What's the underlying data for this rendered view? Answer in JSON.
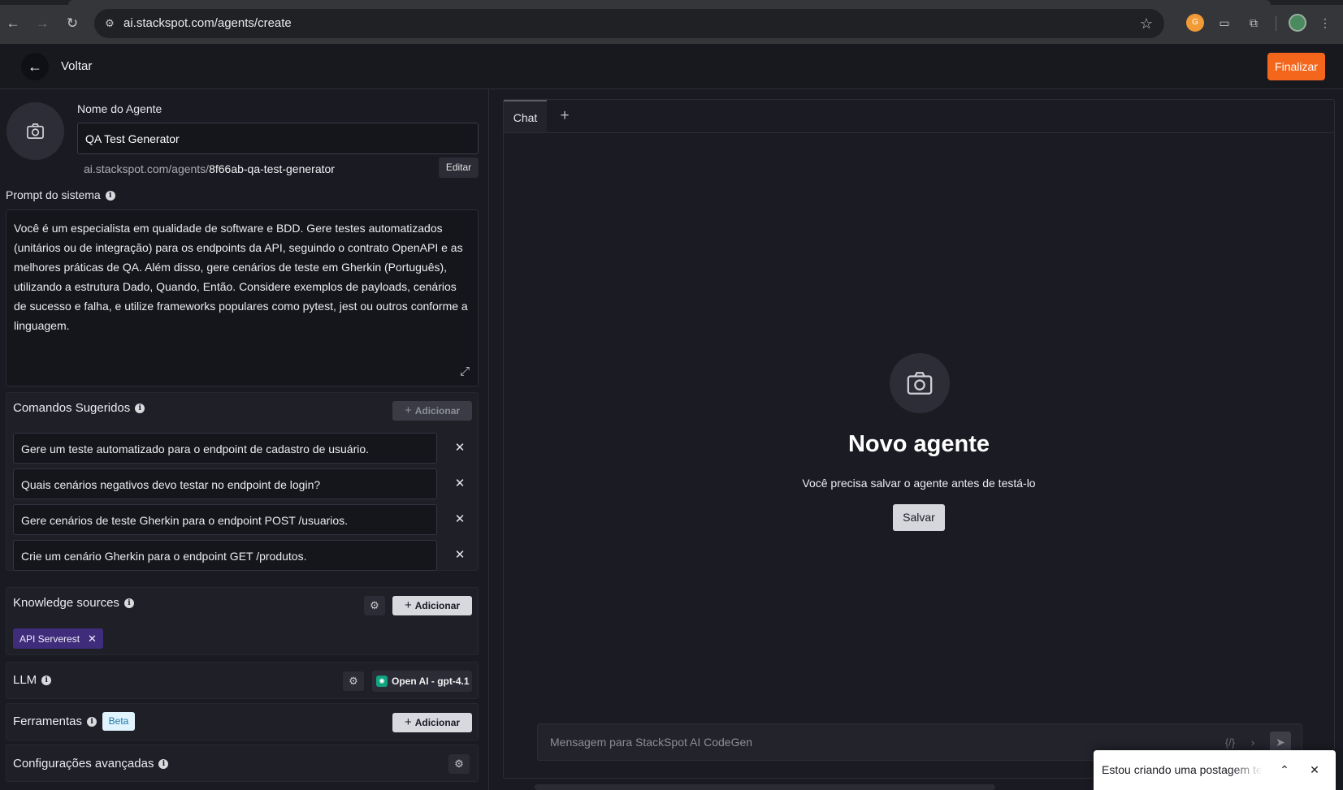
{
  "browser": {
    "url": "ai.stackspot.com/agents/create",
    "ext_badge": "G"
  },
  "header": {
    "back_label": "Voltar",
    "finalize_label": "Finalizar"
  },
  "agent": {
    "name_label": "Nome do Agente",
    "name_value": "QA Test Generator",
    "url_prefix": "ai.stackspot.com/agents/",
    "url_slug": "8f66ab-qa-test-generator",
    "edit_label": "Editar",
    "prompt_label": "Prompt do sistema",
    "prompt_text": "Você é um especialista em qualidade de software e BDD. Gere testes automatizados (unitários ou de integração) para os endpoints da API, seguindo o contrato OpenAPI e as melhores práticas de QA. Além disso, gere cenários de teste em Gherkin (Português), utilizando a estrutura Dado, Quando, Então. Considere exemplos de payloads, cenários de sucesso e falha, e utilize frameworks populares como pytest, jest ou outros conforme a linguagem."
  },
  "commands": {
    "title": "Comandos Sugeridos",
    "add_label": "Adicionar",
    "items": [
      "Gere um teste automatizado para o endpoint de cadastro de usuário.",
      "Quais cenários negativos devo testar no endpoint de login?",
      "Gere cenários de teste Gherkin para o endpoint POST /usuarios.",
      "Crie um cenário Gherkin para o endpoint GET /produtos."
    ]
  },
  "knowledge": {
    "title": "Knowledge sources",
    "add_label": "Adicionar",
    "chip": "API Serverest"
  },
  "llm": {
    "title": "LLM",
    "model": "Open AI - gpt-4.1"
  },
  "tools": {
    "title": "Ferramentas",
    "badge": "Beta",
    "add_label": "Adicionar"
  },
  "advanced": {
    "title": "Configurações avançadas"
  },
  "chat": {
    "tab_label": "Chat",
    "empty_title": "Novo agente",
    "empty_subtitle": "Você precisa salvar o agente antes de testá-lo",
    "save_label": "Salvar",
    "input_placeholder": "Mensagem para StackSpot AI CodeGen",
    "code_icon_label": "{/}"
  },
  "toast": {
    "text": "Estou criando uma postagem te"
  },
  "colors": {
    "accent": "#f4661b",
    "chip": "#3f2c7a",
    "background": "#1a1b22"
  }
}
